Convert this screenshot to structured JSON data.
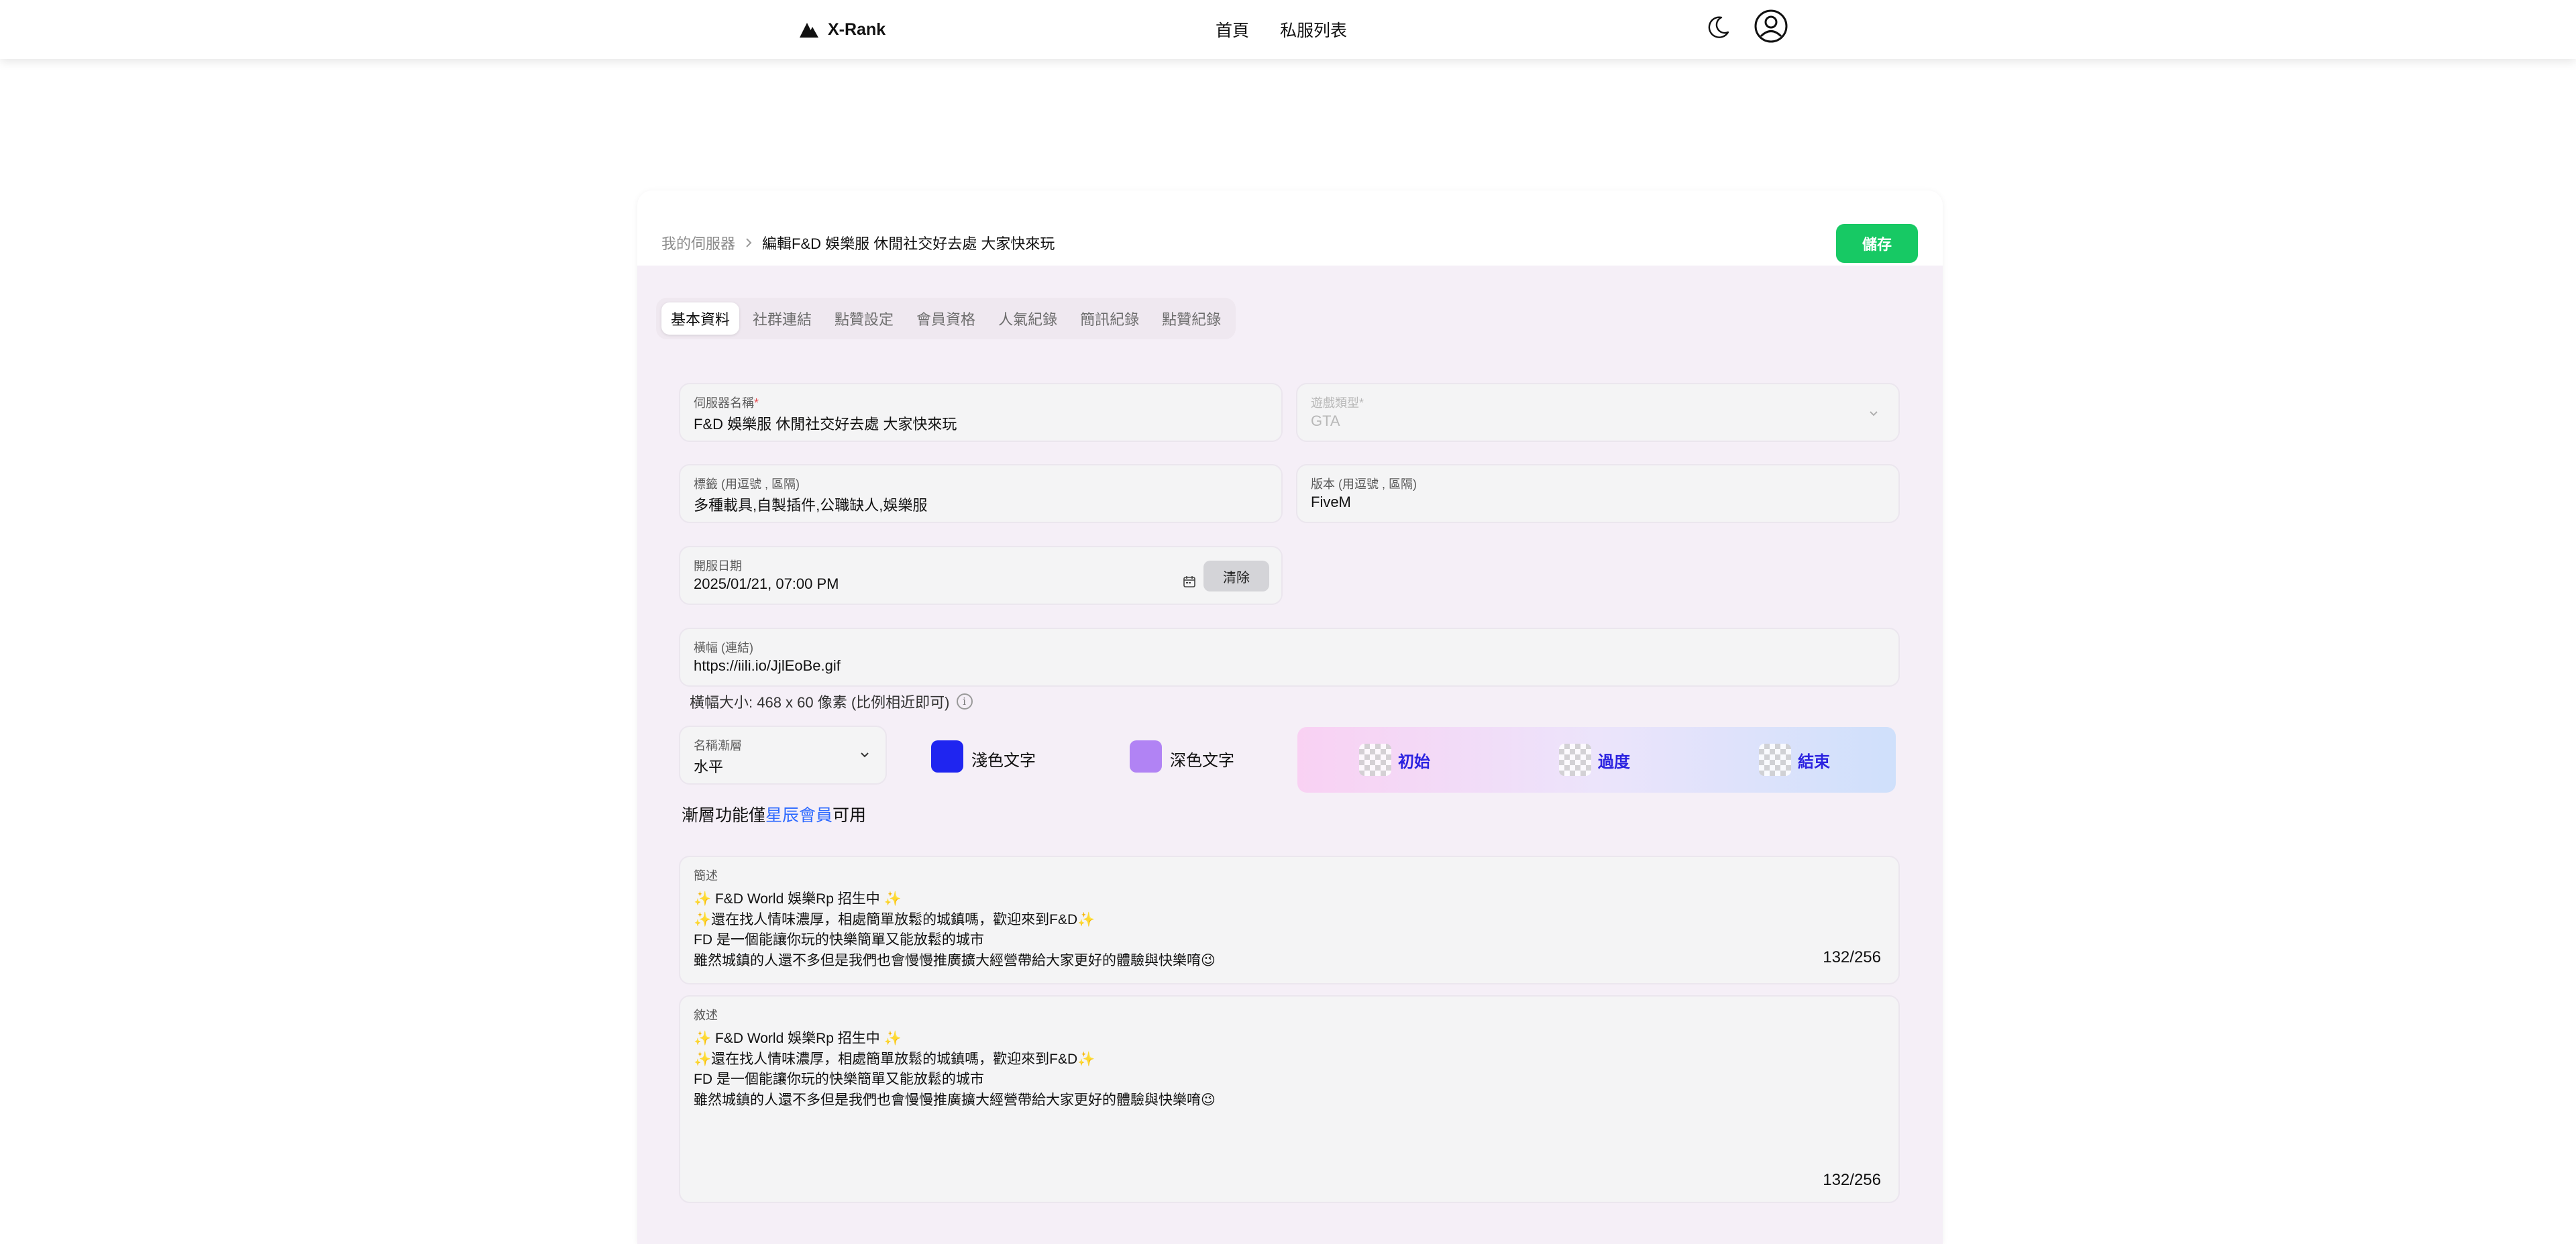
{
  "nav": {
    "brand": "X-Rank",
    "links": [
      "首頁",
      "私服列表"
    ]
  },
  "icons": {
    "brand": "x-rank-logo-icon",
    "theme": "moon-icon",
    "user": "user-circle-icon",
    "calendar": "calendar-icon",
    "chevron": "chevron-down-icon",
    "info": "info-icon",
    "breadcrumb_sep": "chevron-right-icon"
  },
  "breadcrumb": {
    "parent": "我的伺服器",
    "current": "編輯F&D 娛樂服 休閒社交好去處 大家快來玩"
  },
  "save_label": "儲存",
  "tabs": [
    "基本資料",
    "社群連結",
    "點贊設定",
    "會員資格",
    "人氣紀錄",
    "簡訊紀錄",
    "點贊紀錄"
  ],
  "active_tab": "基本資料",
  "form": {
    "server_name": {
      "label": "伺服器名稱",
      "required": "*",
      "value": "F&D 娛樂服 休閒社交好去處 大家快來玩"
    },
    "game_type": {
      "label": "遊戲類型",
      "required": "*",
      "value": "GTA"
    },
    "tags": {
      "label": "標籤 (用逗號 , 區隔)",
      "value": "多種載具,自製插件,公職缺人,娛樂服"
    },
    "version": {
      "label": "版本 (用逗號 , 區隔)",
      "value": "FiveM"
    },
    "open_date": {
      "label": "開服日期",
      "value": "2025/01/21, 07:00 PM",
      "clear_label": "清除"
    },
    "banner": {
      "label": "橫幅 (連結)",
      "value": "https://iili.io/JjlEoBe.gif",
      "helper": "橫幅大小: 468 x 60 像素 (比例相近即可)"
    },
    "name_gradient": {
      "label": "名稱漸層",
      "value": "水平"
    },
    "light_text": {
      "label": "淺色文字",
      "color": "#1f25f0"
    },
    "dark_text": {
      "label": "深色文字",
      "color": "#b183f4"
    },
    "gradient_stops": [
      "初始",
      "過度",
      "結束"
    ],
    "gradient_note": {
      "prefix": "漸層功能僅",
      "link": "星辰會員",
      "suffix": "可用"
    },
    "summary": {
      "label": "簡述",
      "lines": [
        "✨ F&D World  娛樂Rp 招生中 ✨",
        "✨還在找人情味濃厚，相處簡單放鬆的城鎮嗎，歡迎來到F&D✨",
        "FD 是一個能讓你玩的快樂簡單又能放鬆的城市",
        "雖然城鎮的人還不多但是我們也會慢慢推廣擴大經營帶給大家更好的體驗與快樂唷😉"
      ],
      "count": "132/256"
    },
    "description": {
      "label": "敘述",
      "lines": [
        "✨ F&D World  娛樂Rp 招生中 ✨",
        "✨還在找人情味濃厚，相處簡單放鬆的城鎮嗎，歡迎來到F&D✨",
        "FD 是一個能讓你玩的快樂簡單又能放鬆的城市",
        "雖然城鎮的人還不多但是我們也會慢慢推廣擴大經營帶給大家更好的體驗與快樂唷😉"
      ],
      "count": "132/256"
    }
  }
}
